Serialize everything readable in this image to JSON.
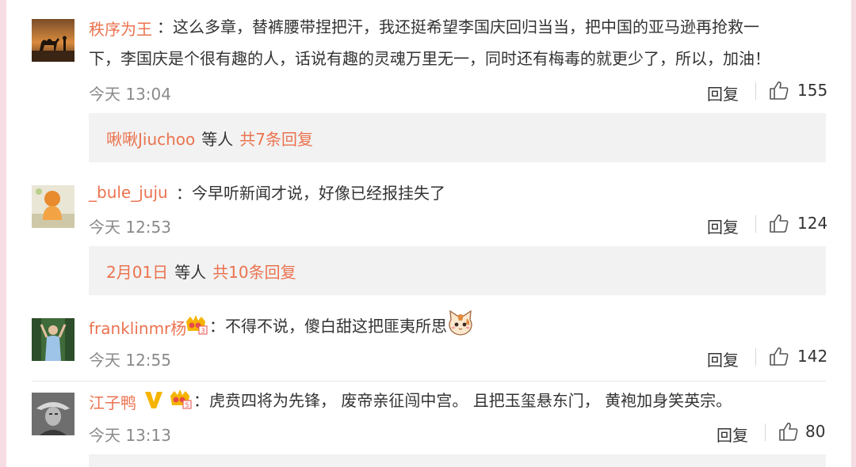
{
  "comments": [
    {
      "username": "秩序为王",
      "line1": "：这么多章，替裤腰带捏把汗，我还挺希望李国庆回归当当，把中国的亚马逊再抢救一",
      "line2": "下，李国庆是个很有趣的人，话说有趣的灵魂万里无一，同时还有梅毒的就更少了，所以，加油！",
      "time": "今天 13:04",
      "reply_label": "回复",
      "likes": "155",
      "sub": {
        "who": "啾啾Jiuchoo",
        "etc": "等人",
        "count": "共7条回复"
      }
    },
    {
      "username": "_bule_juju",
      "text": "：今早听新闻才说，好像已经报挂失了",
      "time": "今天 12:53",
      "reply_label": "回复",
      "likes": "124",
      "sub": {
        "who": "2月01日",
        "etc": "等人",
        "count": "共10条回复"
      }
    },
    {
      "username": "franklinmr杨",
      "text": "：不得不说，傻白甜这把匪夷所思",
      "time": "今天 12:55",
      "reply_label": "回复",
      "likes": "142"
    },
    {
      "username": "江子鸭",
      "text": "：虎贲四将为先锋，  废帝亲征闯中宫。 且把玉玺悬东门，  黄袍加身笑英宗。",
      "time": "今天 13:13",
      "reply_label": "回复",
      "likes": "80"
    }
  ],
  "colors": {
    "username": "#eb7350",
    "text": "#333333",
    "time": "#8a8a8a",
    "sub_bg": "#f2f2f2",
    "frame": "#f6dde3"
  },
  "icons": [
    "thumbs-up-icon",
    "crown-badge-icon",
    "verified-v-icon",
    "cat-emoji-icon"
  ]
}
